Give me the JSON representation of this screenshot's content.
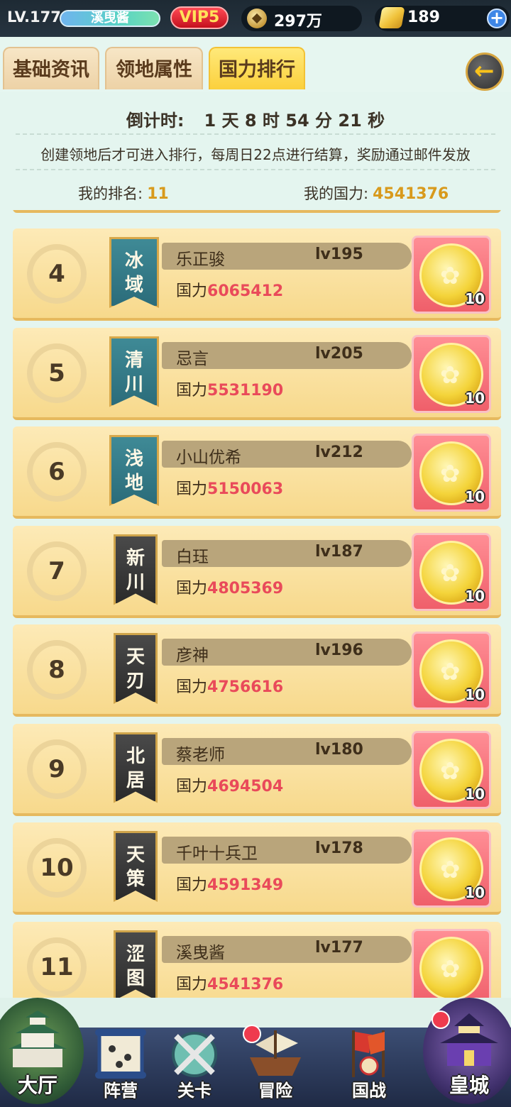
{
  "status": {
    "level": "LV.177",
    "player_name": "溪曳酱",
    "vip": "VIP5",
    "copper": "297万",
    "gold": "189",
    "plus": "+"
  },
  "tabs": [
    {
      "label": "基础资讯"
    },
    {
      "label": "领地属性"
    },
    {
      "label": "国力排行"
    }
  ],
  "active_tab": "国力排行",
  "back_arrow": "←",
  "countdown": {
    "label": "倒计时:",
    "value": "1 天 8 时 54 分 21 秒"
  },
  "rule_text": "创建领地后才可进入排行，每周日22点进行结算，奖励通过邮件发放",
  "my_rank": {
    "label": "我的排名:",
    "value": "11"
  },
  "my_power": {
    "label": "我的国力:",
    "value": "4541376"
  },
  "power_label": "国力",
  "rows": [
    {
      "rank": "4",
      "territory_1": "冰",
      "territory_2": "域",
      "name": "乐正骏",
      "level": "lv195",
      "power": "6065412",
      "reward": "10",
      "banner": "teal"
    },
    {
      "rank": "5",
      "territory_1": "清",
      "territory_2": "川",
      "name": "忌言",
      "level": "lv205",
      "power": "5531190",
      "reward": "10",
      "banner": "teal"
    },
    {
      "rank": "6",
      "territory_1": "浅",
      "territory_2": "地",
      "name": "小山优希",
      "level": "lv212",
      "power": "5150063",
      "reward": "10",
      "banner": "teal"
    },
    {
      "rank": "7",
      "territory_1": "新",
      "territory_2": "川",
      "name": "白珏",
      "level": "lv187",
      "power": "4805369",
      "reward": "10",
      "banner": "dark"
    },
    {
      "rank": "8",
      "territory_1": "天",
      "territory_2": "刃",
      "name": "彦神",
      "level": "lv196",
      "power": "4756616",
      "reward": "10",
      "banner": "dark"
    },
    {
      "rank": "9",
      "territory_1": "北",
      "territory_2": "居",
      "name": "蔡老师",
      "level": "lv180",
      "power": "4694504",
      "reward": "10",
      "banner": "dark"
    },
    {
      "rank": "10",
      "territory_1": "天",
      "territory_2": "策",
      "name": "千叶十兵卫",
      "level": "lv178",
      "power": "4591349",
      "reward": "10",
      "banner": "dark"
    },
    {
      "rank": "11",
      "territory_1": "涩",
      "territory_2": "图",
      "name": "溪曳酱",
      "level": "lv177",
      "power": "4541376",
      "reward": "",
      "banner": "dark"
    }
  ],
  "nav": [
    {
      "label": "大厅",
      "icon": "castle-icon"
    },
    {
      "label": "阵营",
      "icon": "scroll-map-icon"
    },
    {
      "label": "关卡",
      "icon": "crossed-swords-icon"
    },
    {
      "label": "冒险",
      "icon": "ship-icon"
    },
    {
      "label": "国战",
      "icon": "war-banner-icon"
    },
    {
      "label": "皇城",
      "icon": "imperial-palace-icon"
    }
  ],
  "colors": {
    "accent_gold": "#d89a1c",
    "power_red": "#e94a5a",
    "active_tab": "#fbd03c"
  }
}
